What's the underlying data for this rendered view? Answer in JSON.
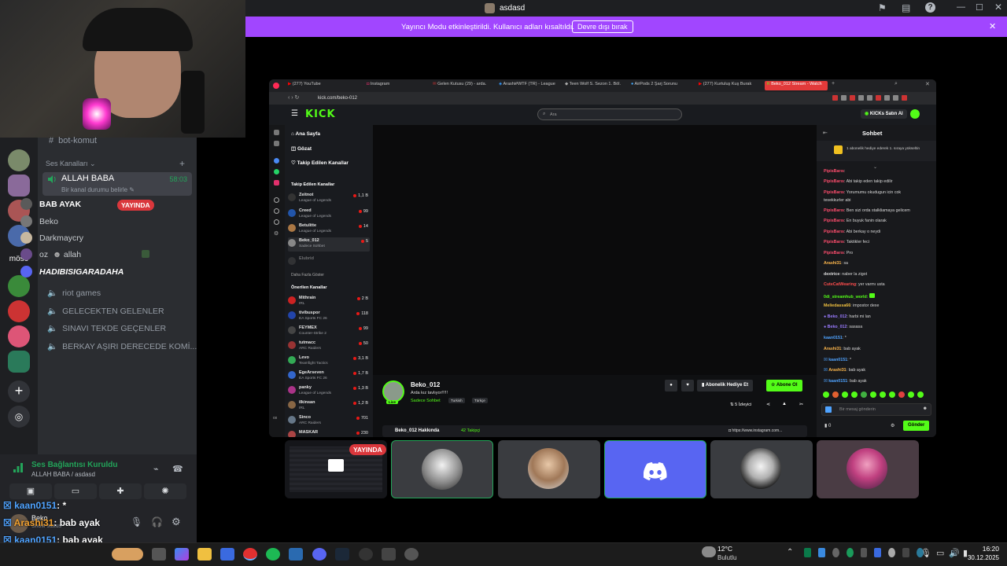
{
  "titlebar": {
    "user_name": "asdasd"
  },
  "notification": {
    "text": "Yayıncı Modu etkinleştirildi. Kullanıcı adları kısaltıldı.",
    "button_label": "Devre dışı bırak"
  },
  "discord": {
    "text_channel": "bot-komut",
    "voice_section_label": "Ses Kanalları",
    "active_channel": {
      "name": "ALLAH BABA",
      "timer": "58:03",
      "status": "Bir kanal durumu belirle"
    },
    "members": [
      {
        "name": "BAB AYAK",
        "badge": "YAYINDA",
        "color": "#5a5a5a"
      },
      {
        "name": "Beko",
        "color": "#777777"
      },
      {
        "name": "Darkmaycry",
        "color": "#c8b8a0"
      },
      {
        "name": "oz",
        "extra": "allah",
        "color": "#6a4b8a"
      },
      {
        "name": "HADIBISIGARADAHA",
        "color": "#5865f2"
      }
    ],
    "other_channels": [
      "riot games",
      "GELECEKTEN GELENLER",
      "SINAVI TEKDE GEÇENLER",
      "BERKAY AŞIRI DERECEDE KOMİ..."
    ],
    "server_label": "mösö",
    "voice_status": {
      "title": "Ses Bağlantısı Kuruldu",
      "subtitle": "ALLAH BABA / asdasd"
    },
    "user_panel": {
      "name": "Beko",
      "status": "Show status"
    }
  },
  "stream_overlay": [
    {
      "user": "kaan0151",
      "msg": ": *",
      "color": "#4fa3ff"
    },
    {
      "user": "Arashi31",
      "msg": ": bab ayak",
      "color": "#f0a030"
    },
    {
      "user": "kaan0151",
      "msg": ": bab ayak",
      "color": "#4fa3ff"
    },
    {
      "user": "0di_streamhub_world",
      "msg": ":",
      "color": "#53fc18"
    }
  ],
  "browser": {
    "tabs": [
      "(277) YouTube",
      "Instagram",
      "Gelen Kutusu (29) - arda.",
      "Arashi#WTF (TR) - League",
      "Teen Wolf S. Sezon 1. Böl.",
      "AirPods 2 Şarj Sorunu",
      "(277) Kurtuluş Kuş Burak",
      "Beko_012 Stream - Watch"
    ],
    "url": "kick.com/beko-012",
    "logo": "KICK",
    "search_placeholder": "Ara",
    "buy_kicks": "KICKs Satın Al"
  },
  "kick_nav": [
    "Ana Sayfa",
    "Gözat",
    "Takip Edilen Kanallar"
  ],
  "followed_header": "Takip Edilen Kanallar",
  "followed": [
    {
      "name": "Zeitnot",
      "game": "League of Legends",
      "viewers": "1,1 B",
      "color": "#333"
    },
    {
      "name": "Creed",
      "game": "League of Legends",
      "viewers": "99",
      "color": "#2255aa"
    },
    {
      "name": "Betulitte",
      "game": "League of Legends",
      "viewers": "14",
      "color": "#aa7744"
    },
    {
      "name": "Beko_012",
      "game": "Sadece Sohbet",
      "viewers": "5",
      "color": "#888"
    },
    {
      "name": "Elubrid",
      "game": "",
      "viewers": "",
      "color": "#555"
    }
  ],
  "show_more": "Daha Fazla Göster",
  "suggested_header": "Önerilen Kanallar",
  "suggested": [
    {
      "name": "Mithrain",
      "game": "IRL",
      "viewers": "2 B",
      "color": "#cc2222"
    },
    {
      "name": "tivibuspor",
      "game": "EA Sports FC 26",
      "viewers": "118",
      "color": "#2244aa"
    },
    {
      "name": "FEYMEX",
      "game": "Counter-Strike 2",
      "viewers": "99",
      "color": "#444"
    },
    {
      "name": "tutmacc",
      "game": "ARC Raiders",
      "viewers": "50",
      "color": "#993333"
    },
    {
      "name": "Levo",
      "game": "Teamfight Tactics",
      "viewers": "3,1 B",
      "color": "#33aa55"
    },
    {
      "name": "EgeArseven",
      "game": "EA Sports FC 26",
      "viewers": "1,7 B",
      "color": "#3366cc"
    },
    {
      "name": "panky",
      "game": "League of Legends",
      "viewers": "1,3 B",
      "color": "#aa3388"
    },
    {
      "name": "ilkinsan",
      "game": "IRL",
      "viewers": "1,2 B",
      "color": "#886644"
    },
    {
      "name": "Sinco",
      "game": "ARC Raiders",
      "viewers": "701",
      "color": "#667788"
    },
    {
      "name": "MASKAR",
      "game": "",
      "viewers": "230",
      "color": "#aa4444"
    }
  ],
  "streamer": {
    "name": "Beko_012",
    "title": "Arda kız tavlıyor!!!!!",
    "category": "Sadece Sohbet",
    "tags": [
      "Turkish",
      "Türkçe"
    ],
    "live": "Live",
    "gift_button": "Abonelik Hediye Et",
    "subscribe_button": "Abone Ol",
    "viewers": "5 İzleyici",
    "about": "Beko_012 Hakkında",
    "followers": "42 Takipçi",
    "instagram": "https://www.instagram.com..."
  },
  "chat": {
    "title": "Sohbet",
    "pinned": "1 abonelik hediye ederek 1. sıraya yükseltin",
    "input_placeholder": "Bir mesaj gönderin",
    "send": "Gönder",
    "kicks_count": "0",
    "messages": [
      {
        "user": "PipisBarıs",
        "msg": ":",
        "color": "#ff4d6d"
      },
      {
        "user": "PipisBarıs",
        "msg": ": Abi takip eden takip edilir",
        "color": "#ff4d6d"
      },
      {
        "user": "PipisBarıs",
        "msg": ": Yorumumu okudugun icin cok",
        "color": "#ff4d6d"
      },
      {
        "user": "",
        "msg": "tesekkurler abi",
        "color": "#ff4d6d"
      },
      {
        "user": "PipisBarıs",
        "msg": ": Ben sizi orda stalkliamaya gelicem",
        "color": "#ff4d6d"
      },
      {
        "user": "PipisBarıs",
        "msg": ": En buyuk fanin olarak",
        "color": "#ff4d6d"
      },
      {
        "user": "PipisBarıs",
        "msg": ": Abi berkay o neydi",
        "color": "#ff4d6d"
      },
      {
        "user": "PipisBarıs",
        "msg": ": Taktikler feci",
        "color": "#ff4d6d"
      },
      {
        "user": "PipisBarıs",
        "msg": ": Pro",
        "color": "#ff4d6d"
      },
      {
        "user": "Arashi31",
        "msg": ": sa",
        "color": "#ffb84d"
      },
      {
        "user": "dextrice",
        "msg": ": naber la zigot",
        "color": "#dddddd"
      },
      {
        "user": "CuteCatWearing",
        "msg": ": yer varmı usta",
        "color": "#ff4d4d"
      },
      {
        "user": "0di_streamhub_world",
        "msg": ":",
        "color": "#53fc18"
      },
      {
        "user": "Meliedassa66",
        "msg": ": impostor dexe",
        "color": "#f0c040"
      },
      {
        "user": "Beko_012",
        "msg": ": harbi mi lan",
        "color": "#9a7bff"
      },
      {
        "user": "Beko_012",
        "msg": ": sasasa",
        "color": "#9a7bff"
      },
      {
        "user": "kaan0151",
        "msg": ": *",
        "color": "#4fa3ff"
      },
      {
        "user": "Arashi31",
        "msg": ": bab ayak",
        "color": "#ffb84d"
      },
      {
        "user": "kaan0151",
        "msg": ": *",
        "color": "#4fa3ff"
      },
      {
        "user": "Arashi31",
        "msg": ": bab ayak",
        "color": "#ffb84d"
      },
      {
        "user": "kaan0151",
        "msg": ": bab ayak",
        "color": "#4fa3ff"
      }
    ]
  },
  "thumbnails": {
    "live_badge": "YAYINDA"
  },
  "taskbar": {
    "weather_temp": "12°C",
    "weather_text": "Bulutlu",
    "time": "16:20",
    "date": "30.12.2025"
  }
}
